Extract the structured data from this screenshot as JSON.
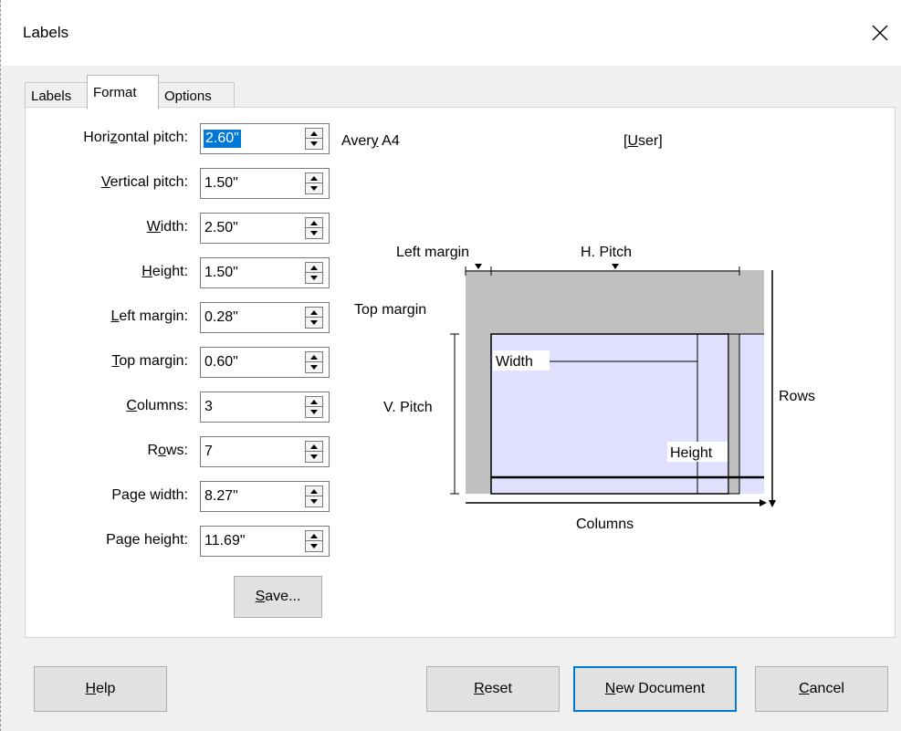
{
  "window": {
    "title": "Labels"
  },
  "tabs": [
    {
      "label": "Labels",
      "active": false
    },
    {
      "label": "Format",
      "active": true
    },
    {
      "label": "Options",
      "active": false
    }
  ],
  "fields": [
    {
      "pre": "Hori",
      "key": "z",
      "post": "ontal pitch:",
      "value": "2.60\"",
      "selected": true
    },
    {
      "pre": "",
      "key": "V",
      "post": "ertical pitch:",
      "value": "1.50\""
    },
    {
      "pre": "",
      "key": "W",
      "post": "idth:",
      "value": "2.50\""
    },
    {
      "pre": "",
      "key": "H",
      "post": "eight:",
      "value": "1.50\""
    },
    {
      "pre": "",
      "key": "L",
      "post": "eft margin:",
      "value": "0.28\""
    },
    {
      "pre": "",
      "key": "T",
      "post": "op margin:",
      "value": "0.60\""
    },
    {
      "pre": "",
      "key": "C",
      "post": "olumns:",
      "value": "3"
    },
    {
      "pre": "R",
      "key": "o",
      "post": "ws:",
      "value": "7"
    },
    {
      "pre": "Pa",
      "key": "g",
      "post": "e width:",
      "value": "8.27\""
    },
    {
      "pre": "Pa",
      "key": "g",
      "post": "e height:",
      "value": "11.69\""
    }
  ],
  "save_button": {
    "key": "S",
    "post": "ave..."
  },
  "label_info": {
    "brand_pre": "Aver",
    "brand_key": "y",
    "brand_post": " A4",
    "type_pre": "[",
    "type_key": "U",
    "type_post": "ser]"
  },
  "diagram": {
    "left_margin": "Left margin",
    "h_pitch": "H. Pitch",
    "top_margin": "Top margin",
    "v_pitch": "V. Pitch",
    "width": "Width",
    "height": "Height",
    "rows": "Rows",
    "columns": "Columns",
    "colors": {
      "page": "#c0c0c0",
      "label": "#e0e0ff"
    }
  },
  "buttons": {
    "help": {
      "key": "H",
      "post": "elp"
    },
    "reset": {
      "key": "R",
      "post": "eset"
    },
    "new_document": {
      "key": "N",
      "post": "ew Document"
    },
    "cancel": {
      "key": "C",
      "post": "ancel"
    }
  }
}
